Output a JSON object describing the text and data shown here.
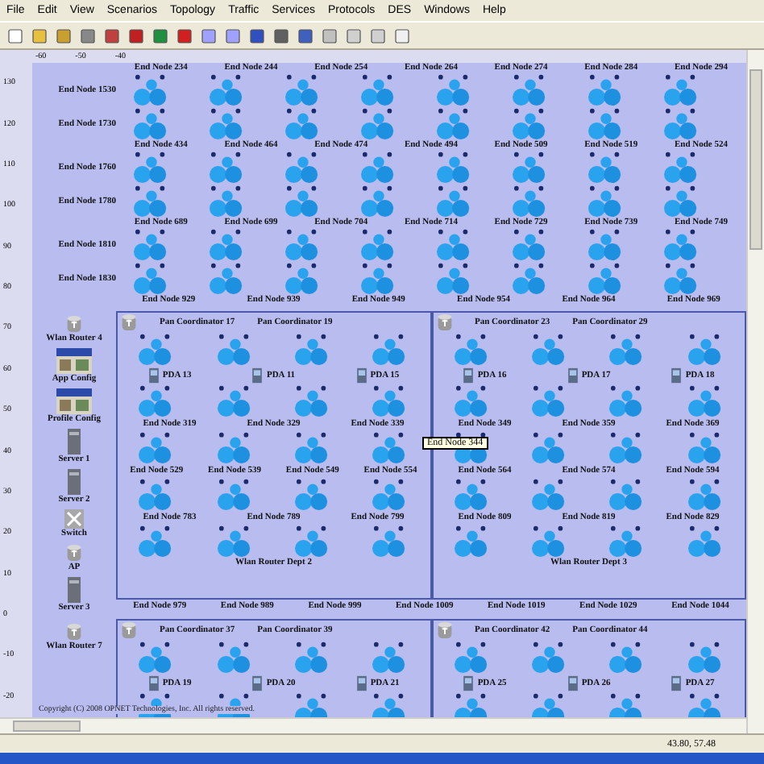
{
  "menu": [
    "File",
    "Edit",
    "View",
    "Scenarios",
    "Topology",
    "Traffic",
    "Services",
    "Protocols",
    "DES",
    "Windows",
    "Help"
  ],
  "top_ruler": [
    "-60",
    "-50",
    "-40"
  ],
  "left_ruler": [
    "130",
    "120",
    "110",
    "100",
    "90",
    "80",
    "70",
    "60",
    "50",
    "40",
    "30",
    "20",
    "10",
    "0",
    "-10",
    "-20"
  ],
  "top_block": [
    {
      "kind": "labels",
      "labels": [
        "End Node 234",
        "End Node 244",
        "End Node 254",
        "End Node 264",
        "End Node 274",
        "End Node 284",
        "End Node 294"
      ]
    },
    {
      "kind": "clusters",
      "side": "End Node 1530"
    },
    {
      "kind": "clusters",
      "side": "End Node 1730"
    },
    {
      "kind": "labels",
      "labels": [
        "End Node 434",
        "End Node 464",
        "End Node 474",
        "End Node 494",
        "End Node 509",
        "End Node 519",
        "End Node 524"
      ]
    },
    {
      "kind": "clusters",
      "side": "End Node 1760"
    },
    {
      "kind": "clusters",
      "side": "End Node 1780"
    },
    {
      "kind": "labels",
      "labels": [
        "End Node 689",
        "End Node 699",
        "End Node 704",
        "End Node 714",
        "End Node 729",
        "End Node 739",
        "End Node 749"
      ]
    },
    {
      "kind": "clusters",
      "side": "End Node 1810"
    },
    {
      "kind": "clusters",
      "side": "End Node 1830"
    },
    {
      "kind": "labels",
      "labels": [
        "End Node 929",
        "End Node 939",
        "End Node 949",
        "End Node 954",
        "End Node 964",
        "End Node 969"
      ]
    }
  ],
  "bands": [
    {
      "side": {
        "router": "Wlan Router 4",
        "objects": [
          {
            "kind": "config",
            "label": "App Config"
          },
          {
            "kind": "config",
            "label": "Profile Config"
          },
          {
            "kind": "server",
            "label": "Server 1"
          },
          {
            "kind": "server",
            "label": "Server 2"
          },
          {
            "kind": "switch",
            "label": "Switch"
          },
          {
            "kind": "ap",
            "label": "AP"
          },
          {
            "kind": "server",
            "label": "Server 3"
          }
        ]
      },
      "subnets": [
        {
          "router": "Wlan Router Dept 2",
          "coordinators": [
            "Pan Coordinator 17",
            "Pan Coordinator 19"
          ],
          "pdas": [
            "PDA 13",
            "PDA 11",
            "PDA 15"
          ],
          "rows": [
            [
              "End Node 319",
              "End Node 329",
              "End Node 339"
            ],
            [
              "End Node 529",
              "End Node 539",
              "End Node 549",
              "End Node 554"
            ],
            [
              "End Node 783",
              "End Node 789",
              "End Node 799"
            ]
          ]
        },
        {
          "router": "Wlan Router Dept 3",
          "coordinators": [
            "Pan Coordinator 23",
            "Pan Coordinator 29"
          ],
          "pdas": [
            "PDA 16",
            "PDA 17",
            "PDA 18"
          ],
          "rows": [
            [
              "End Node 349",
              "End Node 359",
              "End Node 369"
            ],
            [
              "End Node 564",
              "End Node 574",
              "End Node 594"
            ],
            [
              "End Node 809",
              "End Node 819",
              "End Node 829"
            ]
          ]
        }
      ],
      "tooltip": "End Node 344",
      "footer": [
        "End Node 979",
        "End Node 989",
        "End Node 999",
        "End Node 1009",
        "End Node 1019",
        "End Node 1029",
        "End Node 1044"
      ]
    },
    {
      "side": {
        "router": "Wlan Router 7"
      },
      "subnets": [
        {
          "coordinators": [
            "Pan Coordinator 37",
            "Pan Coordinator 39"
          ],
          "pdas": [
            "PDA 19",
            "PDA 20",
            "PDA 21"
          ]
        },
        {
          "coordinators": [
            "Pan Coordinator 42",
            "Pan Coordinator 44"
          ],
          "pdas": [
            "PDA 25",
            "PDA 26",
            "PDA 27"
          ]
        }
      ]
    }
  ],
  "copyright": "Copyright (C) 2008 OPNET Technologies, Inc. All rights reserved.",
  "status": "43.80, 57.48"
}
